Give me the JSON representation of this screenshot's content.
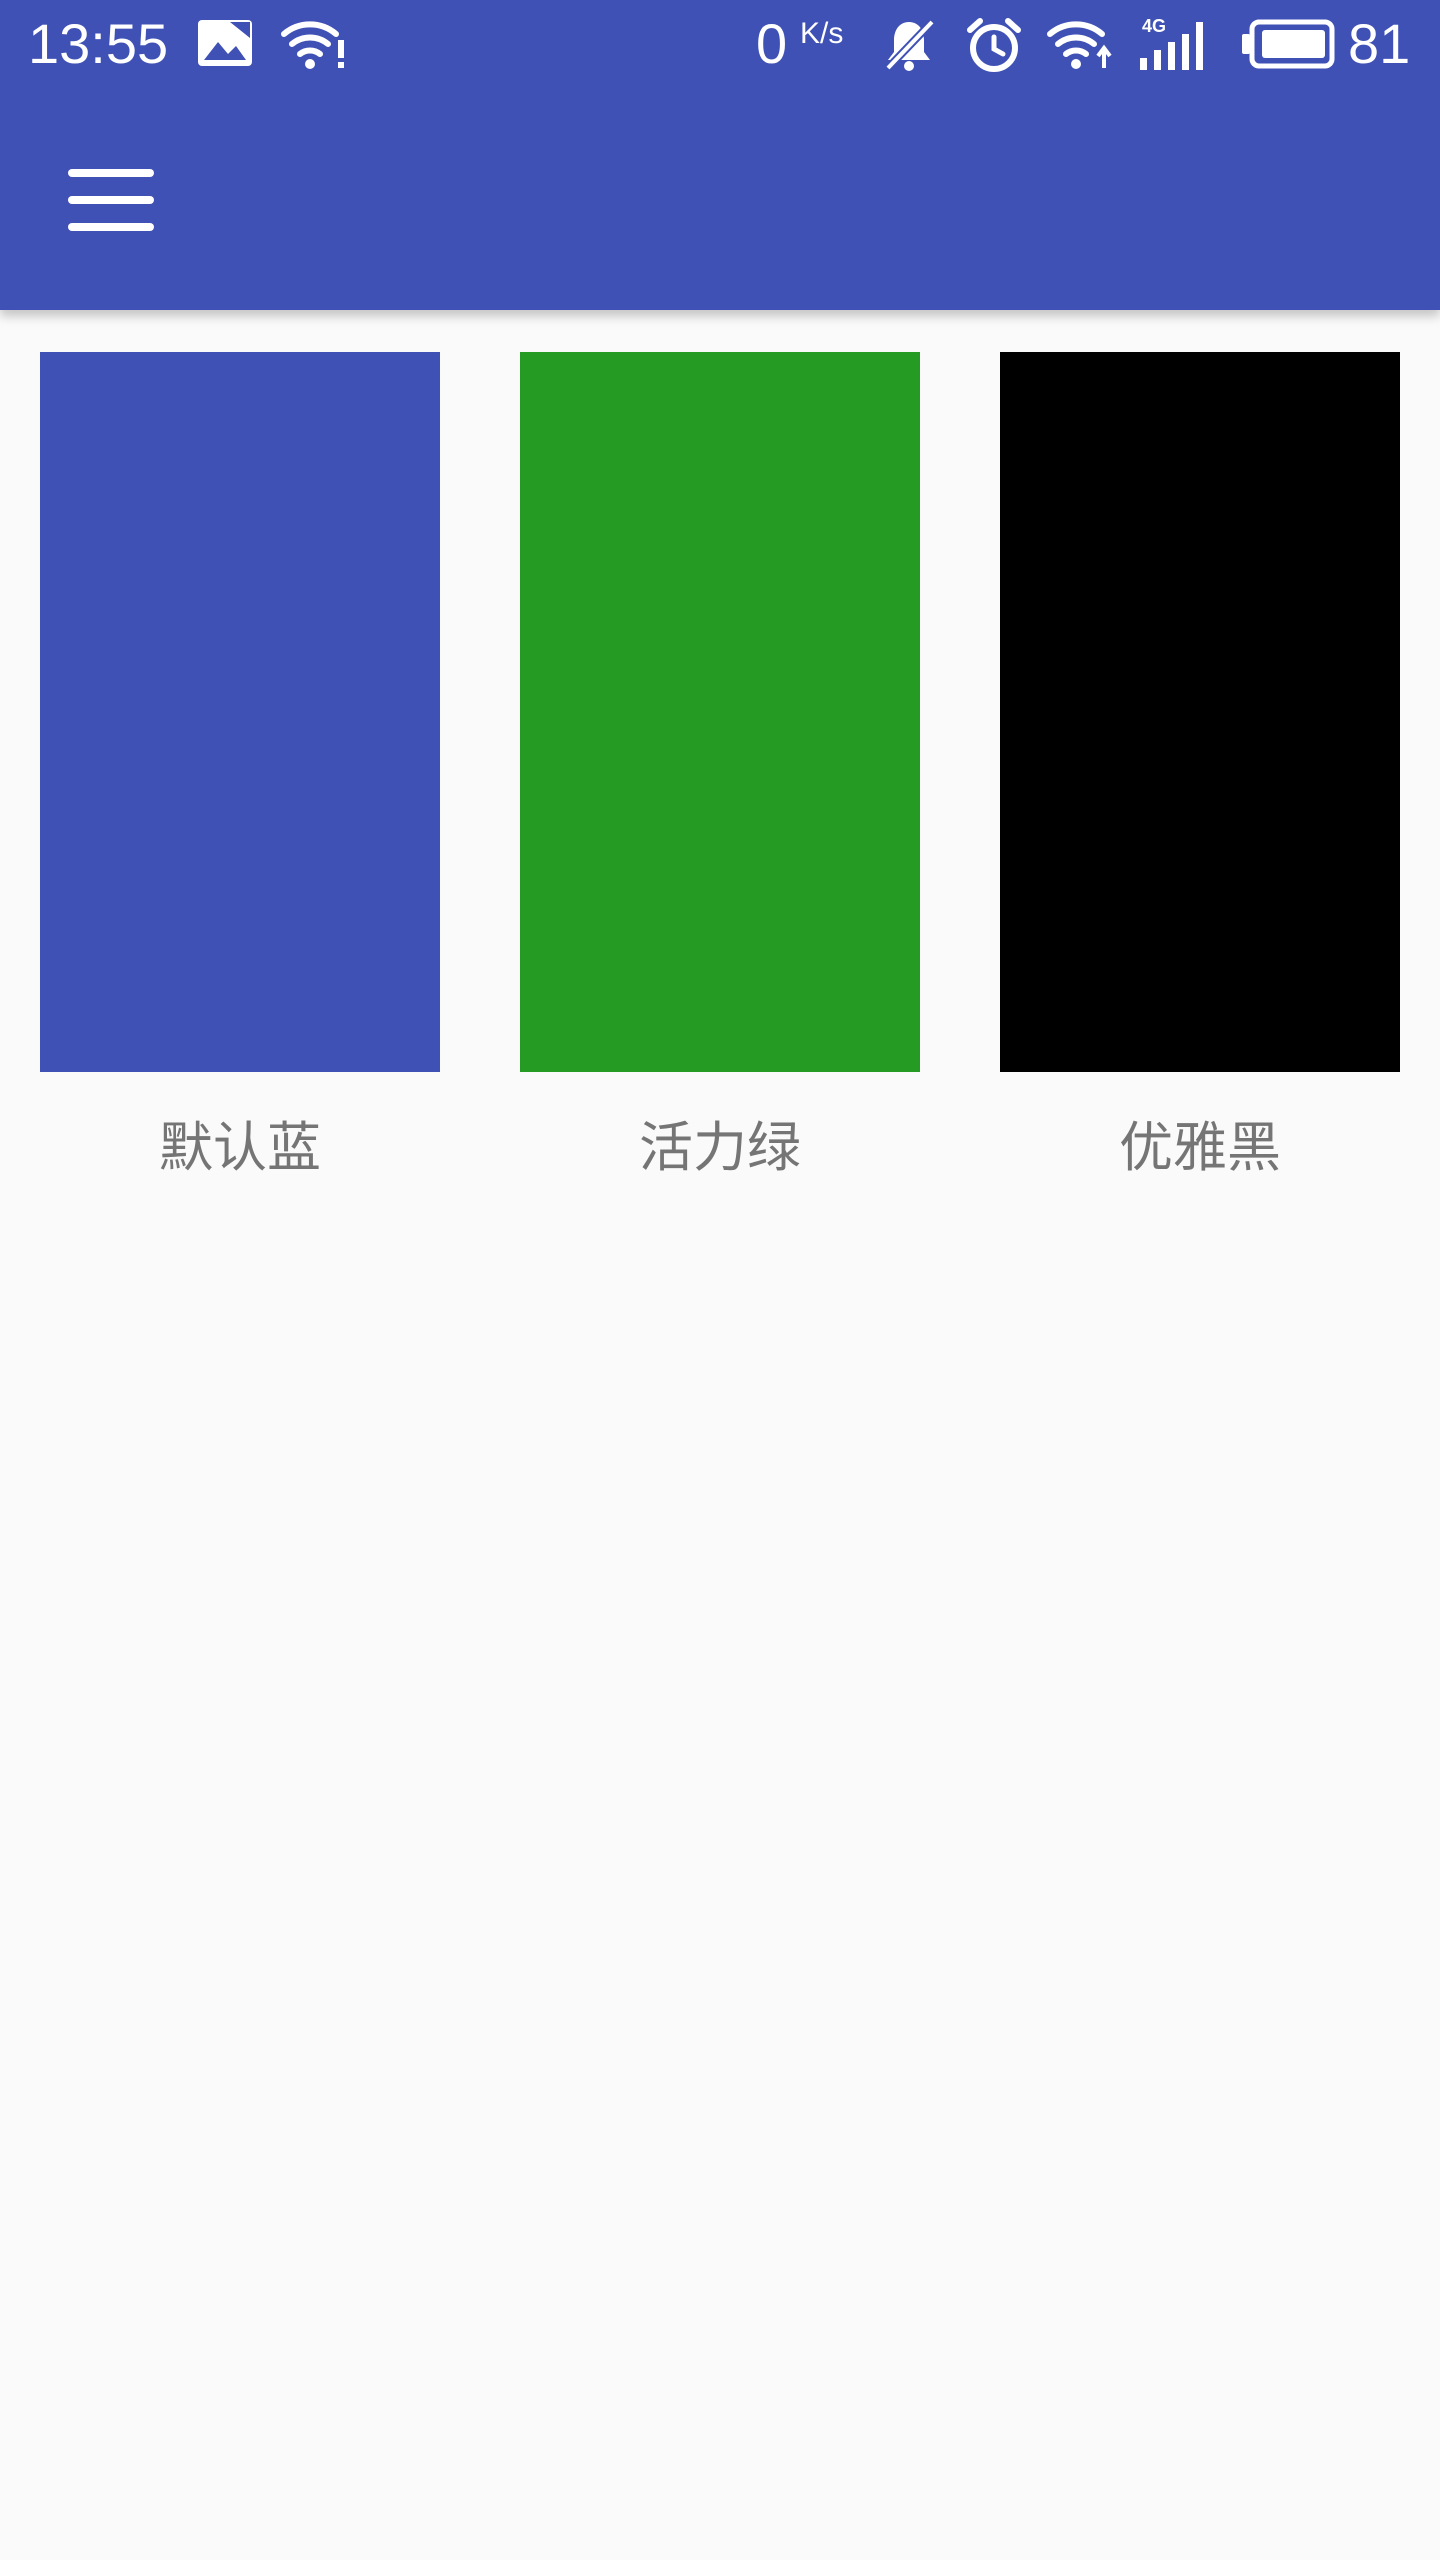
{
  "status_bar": {
    "time": "13:55",
    "net_speed_value": "0",
    "net_speed_unit": "K/s",
    "battery": "81",
    "network_type": "4G",
    "icons": [
      "image-icon",
      "wifi-alert-icon",
      "bell-off-icon",
      "alarm-icon",
      "wifi-up-icon",
      "signal-icon",
      "battery-icon"
    ]
  },
  "app_bar": {
    "menu_icon": "hamburger-menu-icon",
    "color": "#3f51b5"
  },
  "themes": [
    {
      "label": "默认蓝",
      "color": "#3f51b5"
    },
    {
      "label": "活力绿",
      "color": "#259b24"
    },
    {
      "label": "优雅黑",
      "color": "#000000"
    }
  ]
}
